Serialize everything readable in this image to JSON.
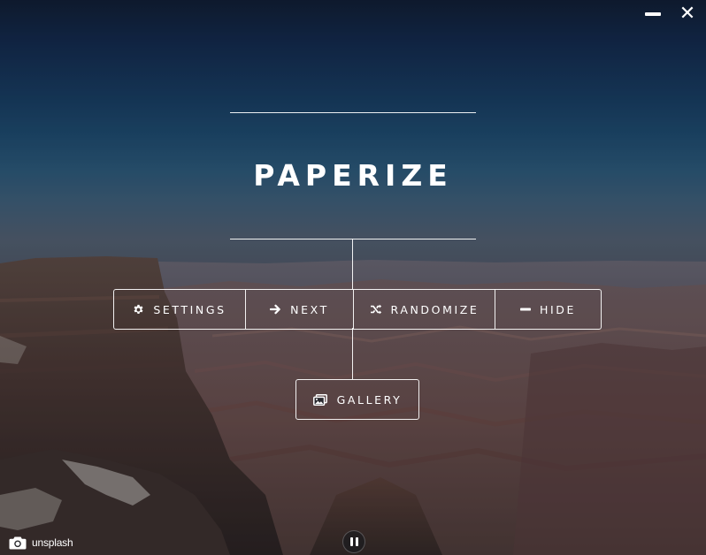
{
  "app": {
    "title": "PAPERIZE"
  },
  "window_controls": {
    "minimize_icon": "minimize-icon",
    "close_icon": "close-icon"
  },
  "menu": {
    "items": [
      {
        "id": "settings",
        "label": "SETTINGS",
        "icon": "gear-icon"
      },
      {
        "id": "next",
        "label": "NEXT",
        "icon": "arrow-right-icon"
      },
      {
        "id": "randomize",
        "label": "RANDOMIZE",
        "icon": "shuffle-icon"
      },
      {
        "id": "hide",
        "label": "HIDE",
        "icon": "minus-icon"
      }
    ],
    "gallery": {
      "label": "GALLERY",
      "icon": "images-icon"
    }
  },
  "footer": {
    "credit_label": "unsplash",
    "credit_icon": "camera-icon",
    "pause_icon": "pause-icon"
  },
  "colors": {
    "sky_top": "#0f1c31",
    "sky_mid": "#1d4a6d",
    "canyon_rock": "#6e4a3e",
    "line": "#ffffff"
  }
}
